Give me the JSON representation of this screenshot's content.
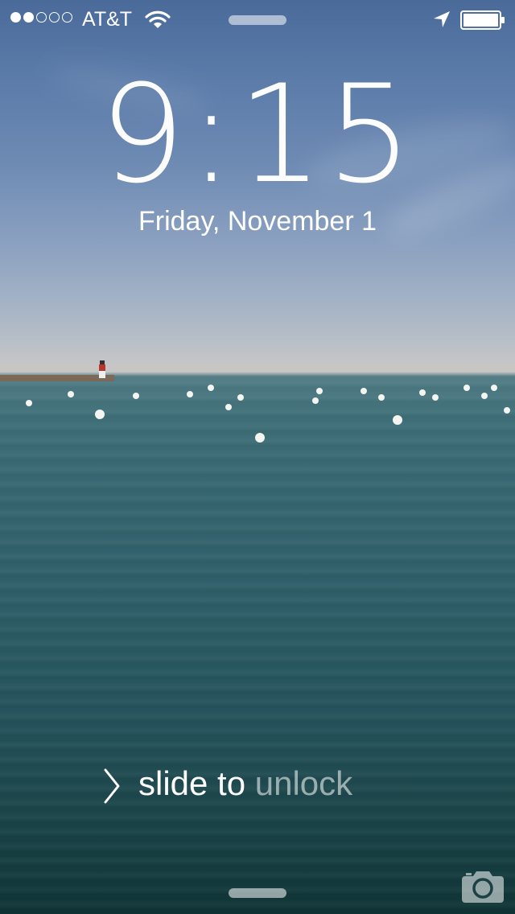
{
  "status_bar": {
    "signal_filled": 2,
    "signal_total": 5,
    "carrier": "AT&T",
    "wifi_icon": "wifi-icon",
    "location_icon": "location-arrow-icon",
    "battery_icon": "battery-icon"
  },
  "lock_screen": {
    "time": "9:15",
    "date": "Friday, November 1",
    "slide_prefix": "slide to",
    "slide_suffix": "unlock",
    "chevron_icon": "chevron-right-icon",
    "camera_icon": "camera-icon"
  },
  "colors": {
    "text": "#ffffff",
    "sky": "#5a7aa8",
    "water": "#2d5d66"
  }
}
